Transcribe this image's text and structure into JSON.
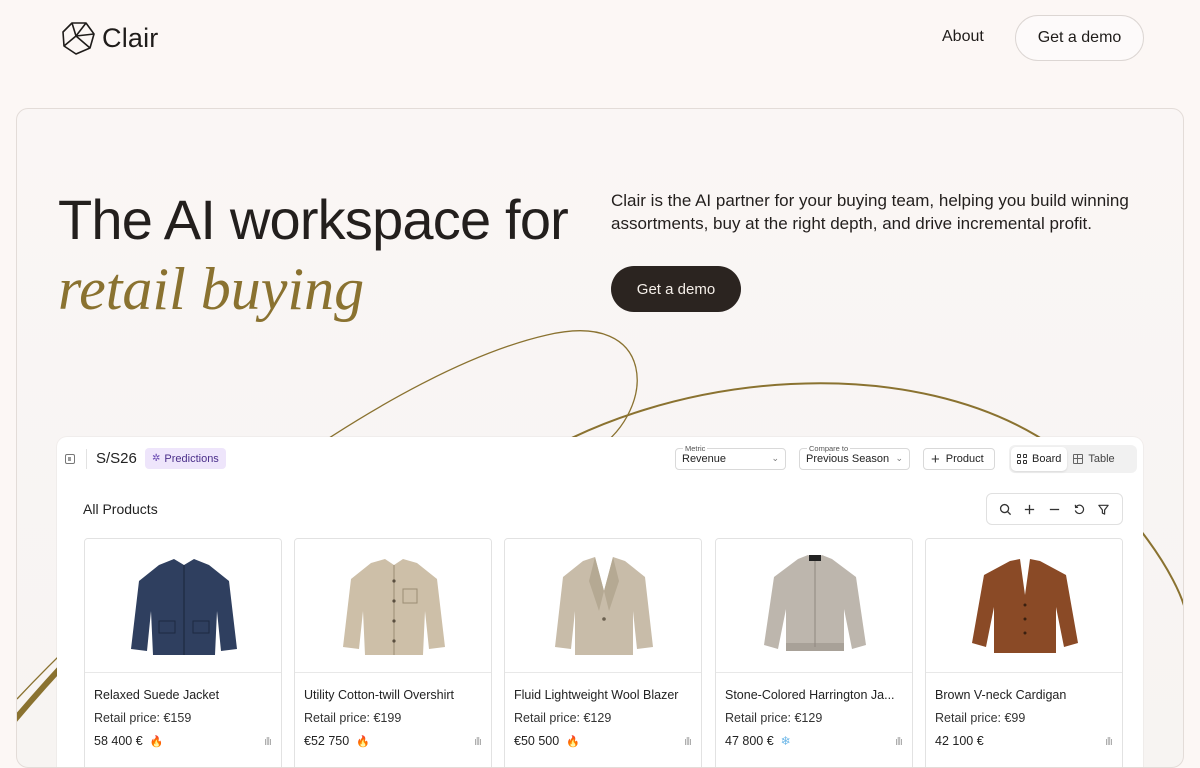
{
  "nav": {
    "brand": "Clair",
    "about": "About",
    "demo": "Get a demo"
  },
  "hero": {
    "headline": "The AI workspace for",
    "headline_accent": "retail buying",
    "description": "Clair is the AI partner for your buying team, helping you build winning assortments, buy at the right depth, and drive incremental profit.",
    "cta": "Get a demo",
    "accent_color": "#8a7230"
  },
  "app": {
    "season": "S/S26",
    "badge": "Predictions",
    "metric_caption": "Metric",
    "metric_value": "Revenue",
    "compare_caption": "Compare to",
    "compare_value": "Previous Season",
    "add_product": "Product",
    "view_board": "Board",
    "view_table": "Table",
    "section_title": "All Products",
    "tools": [
      "search-icon",
      "zoom-in-icon",
      "zoom-out-icon",
      "reset-icon",
      "filter-icon"
    ],
    "products": [
      {
        "name": "Relaxed Suede Jacket",
        "price": "Retail price: €159",
        "metric": "58 400 €",
        "trend": "flame-icon",
        "color": "#2f3f5f"
      },
      {
        "name": "Utility Cotton-twill Overshirt",
        "price": "Retail price: €199",
        "metric": "€52 750",
        "trend": "flame-icon",
        "color": "#cdbfa8"
      },
      {
        "name": "Fluid Lightweight Wool Blazer",
        "price": "Retail price: €129",
        "metric": "€50 500",
        "trend": "flame-icon",
        "color": "#c8bca9"
      },
      {
        "name": "Stone-Colored Harrington Ja...",
        "price": "Retail price: €129",
        "metric": "47 800 €",
        "trend": "snowflake-icon",
        "color": "#bdb6ad"
      },
      {
        "name": "Brown V-neck Cardigan",
        "price": "Retail price: €99",
        "metric": "42 100 €",
        "trend": "none",
        "color": "#8a4a26"
      }
    ]
  }
}
